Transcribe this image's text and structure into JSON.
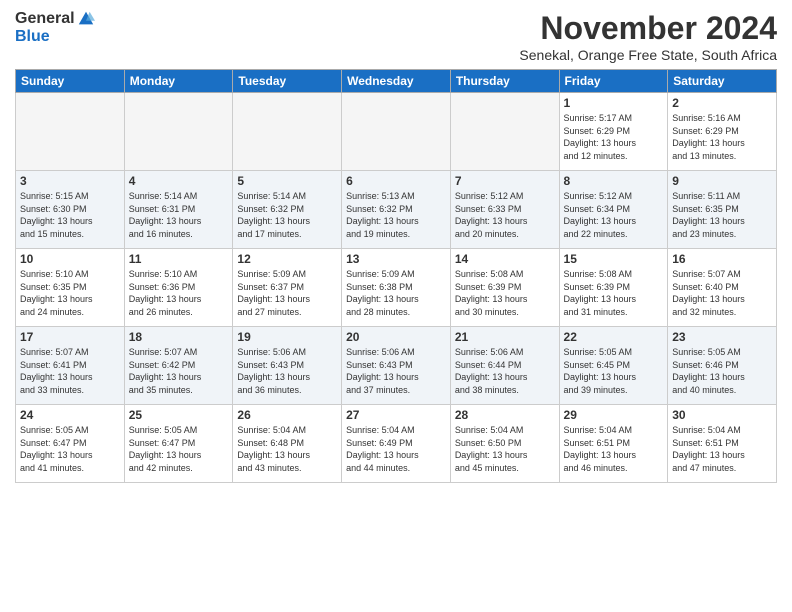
{
  "logo": {
    "general": "General",
    "blue": "Blue"
  },
  "title": "November 2024",
  "location": "Senekal, Orange Free State, South Africa",
  "days_of_week": [
    "Sunday",
    "Monday",
    "Tuesday",
    "Wednesday",
    "Thursday",
    "Friday",
    "Saturday"
  ],
  "weeks": [
    [
      {
        "day": "",
        "info": ""
      },
      {
        "day": "",
        "info": ""
      },
      {
        "day": "",
        "info": ""
      },
      {
        "day": "",
        "info": ""
      },
      {
        "day": "",
        "info": ""
      },
      {
        "day": "1",
        "info": "Sunrise: 5:17 AM\nSunset: 6:29 PM\nDaylight: 13 hours\nand 12 minutes."
      },
      {
        "day": "2",
        "info": "Sunrise: 5:16 AM\nSunset: 6:29 PM\nDaylight: 13 hours\nand 13 minutes."
      }
    ],
    [
      {
        "day": "3",
        "info": "Sunrise: 5:15 AM\nSunset: 6:30 PM\nDaylight: 13 hours\nand 15 minutes."
      },
      {
        "day": "4",
        "info": "Sunrise: 5:14 AM\nSunset: 6:31 PM\nDaylight: 13 hours\nand 16 minutes."
      },
      {
        "day": "5",
        "info": "Sunrise: 5:14 AM\nSunset: 6:32 PM\nDaylight: 13 hours\nand 17 minutes."
      },
      {
        "day": "6",
        "info": "Sunrise: 5:13 AM\nSunset: 6:32 PM\nDaylight: 13 hours\nand 19 minutes."
      },
      {
        "day": "7",
        "info": "Sunrise: 5:12 AM\nSunset: 6:33 PM\nDaylight: 13 hours\nand 20 minutes."
      },
      {
        "day": "8",
        "info": "Sunrise: 5:12 AM\nSunset: 6:34 PM\nDaylight: 13 hours\nand 22 minutes."
      },
      {
        "day": "9",
        "info": "Sunrise: 5:11 AM\nSunset: 6:35 PM\nDaylight: 13 hours\nand 23 minutes."
      }
    ],
    [
      {
        "day": "10",
        "info": "Sunrise: 5:10 AM\nSunset: 6:35 PM\nDaylight: 13 hours\nand 24 minutes."
      },
      {
        "day": "11",
        "info": "Sunrise: 5:10 AM\nSunset: 6:36 PM\nDaylight: 13 hours\nand 26 minutes."
      },
      {
        "day": "12",
        "info": "Sunrise: 5:09 AM\nSunset: 6:37 PM\nDaylight: 13 hours\nand 27 minutes."
      },
      {
        "day": "13",
        "info": "Sunrise: 5:09 AM\nSunset: 6:38 PM\nDaylight: 13 hours\nand 28 minutes."
      },
      {
        "day": "14",
        "info": "Sunrise: 5:08 AM\nSunset: 6:39 PM\nDaylight: 13 hours\nand 30 minutes."
      },
      {
        "day": "15",
        "info": "Sunrise: 5:08 AM\nSunset: 6:39 PM\nDaylight: 13 hours\nand 31 minutes."
      },
      {
        "day": "16",
        "info": "Sunrise: 5:07 AM\nSunset: 6:40 PM\nDaylight: 13 hours\nand 32 minutes."
      }
    ],
    [
      {
        "day": "17",
        "info": "Sunrise: 5:07 AM\nSunset: 6:41 PM\nDaylight: 13 hours\nand 33 minutes."
      },
      {
        "day": "18",
        "info": "Sunrise: 5:07 AM\nSunset: 6:42 PM\nDaylight: 13 hours\nand 35 minutes."
      },
      {
        "day": "19",
        "info": "Sunrise: 5:06 AM\nSunset: 6:43 PM\nDaylight: 13 hours\nand 36 minutes."
      },
      {
        "day": "20",
        "info": "Sunrise: 5:06 AM\nSunset: 6:43 PM\nDaylight: 13 hours\nand 37 minutes."
      },
      {
        "day": "21",
        "info": "Sunrise: 5:06 AM\nSunset: 6:44 PM\nDaylight: 13 hours\nand 38 minutes."
      },
      {
        "day": "22",
        "info": "Sunrise: 5:05 AM\nSunset: 6:45 PM\nDaylight: 13 hours\nand 39 minutes."
      },
      {
        "day": "23",
        "info": "Sunrise: 5:05 AM\nSunset: 6:46 PM\nDaylight: 13 hours\nand 40 minutes."
      }
    ],
    [
      {
        "day": "24",
        "info": "Sunrise: 5:05 AM\nSunset: 6:47 PM\nDaylight: 13 hours\nand 41 minutes."
      },
      {
        "day": "25",
        "info": "Sunrise: 5:05 AM\nSunset: 6:47 PM\nDaylight: 13 hours\nand 42 minutes."
      },
      {
        "day": "26",
        "info": "Sunrise: 5:04 AM\nSunset: 6:48 PM\nDaylight: 13 hours\nand 43 minutes."
      },
      {
        "day": "27",
        "info": "Sunrise: 5:04 AM\nSunset: 6:49 PM\nDaylight: 13 hours\nand 44 minutes."
      },
      {
        "day": "28",
        "info": "Sunrise: 5:04 AM\nSunset: 6:50 PM\nDaylight: 13 hours\nand 45 minutes."
      },
      {
        "day": "29",
        "info": "Sunrise: 5:04 AM\nSunset: 6:51 PM\nDaylight: 13 hours\nand 46 minutes."
      },
      {
        "day": "30",
        "info": "Sunrise: 5:04 AM\nSunset: 6:51 PM\nDaylight: 13 hours\nand 47 minutes."
      }
    ]
  ]
}
